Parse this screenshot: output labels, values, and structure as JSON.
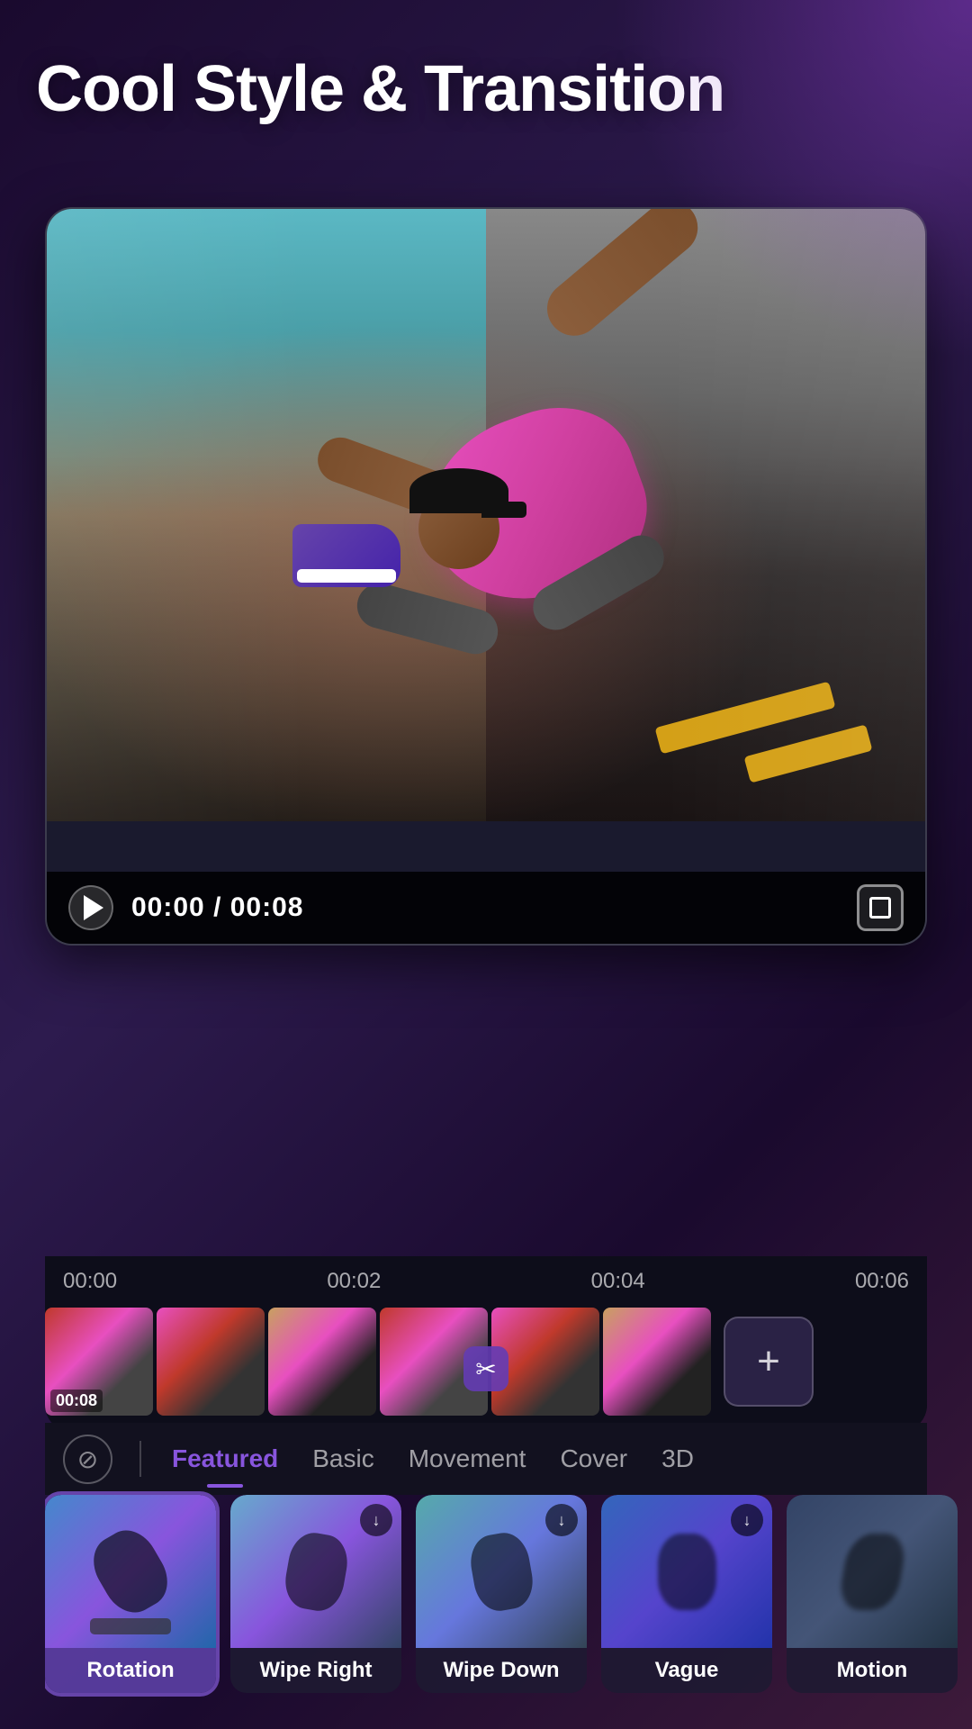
{
  "app": {
    "title": "Cool Style & Transition",
    "bg_color": "#1a0a2e"
  },
  "video": {
    "current_time": "00:00",
    "total_time": "00:08",
    "time_display": "00:00 / 00:08"
  },
  "timeline": {
    "markers": [
      "00:00",
      "00:02",
      "00:04",
      "00:06"
    ],
    "thumbnail_timestamp": "00:08"
  },
  "tabs": {
    "no_transition_label": "⊘",
    "items": [
      {
        "id": "featured",
        "label": "Featured",
        "active": true
      },
      {
        "id": "basic",
        "label": "Basic",
        "active": false
      },
      {
        "id": "movement",
        "label": "Movement",
        "active": false
      },
      {
        "id": "cover",
        "label": "Cover",
        "active": false
      },
      {
        "id": "3d",
        "label": "3D",
        "active": false
      }
    ]
  },
  "transitions": [
    {
      "id": "rotation",
      "label": "Rotation",
      "selected": true,
      "has_download": false
    },
    {
      "id": "wipe-right",
      "label": "Wipe Right",
      "selected": false,
      "has_download": true
    },
    {
      "id": "wipe-down",
      "label": "Wipe Down",
      "selected": false,
      "has_download": true
    },
    {
      "id": "vague",
      "label": "Vague",
      "selected": false,
      "has_download": true
    },
    {
      "id": "motion",
      "label": "Motion",
      "selected": false,
      "has_download": false
    }
  ],
  "buttons": {
    "play": "▶",
    "add": "+",
    "download": "↓"
  }
}
